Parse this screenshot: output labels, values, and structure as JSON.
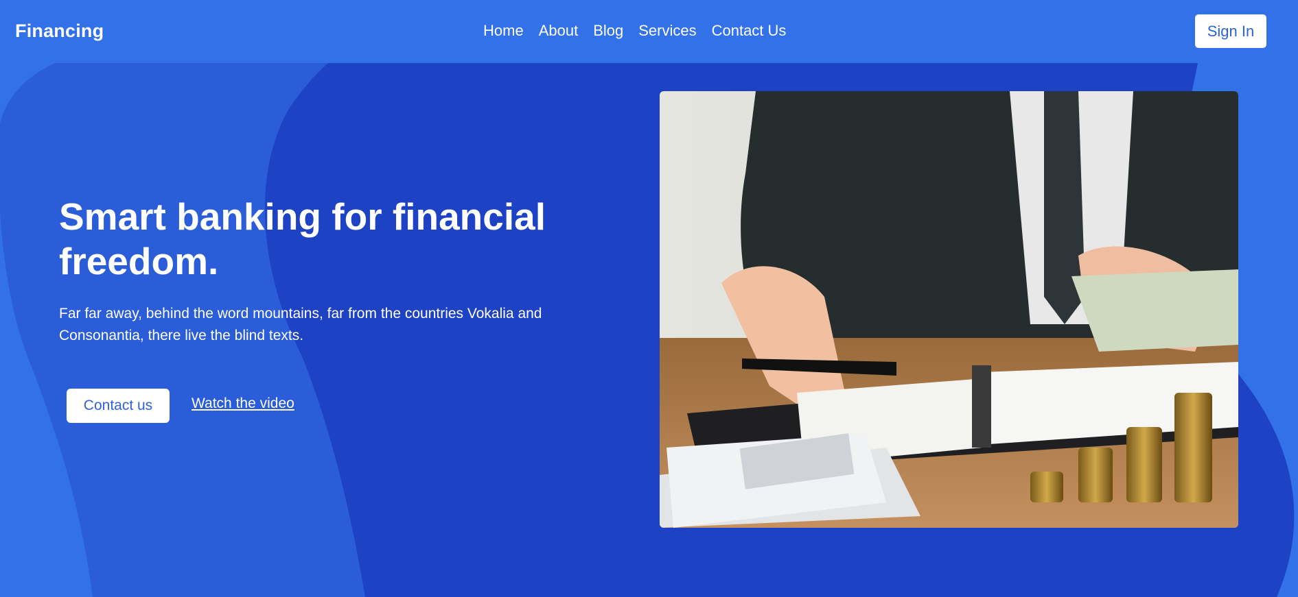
{
  "brand": {
    "name": "Financing"
  },
  "nav": {
    "items": [
      {
        "label": "Home"
      },
      {
        "label": "About"
      },
      {
        "label": "Blog"
      },
      {
        "label": "Services"
      },
      {
        "label": "Contact Us"
      }
    ],
    "signin_label": "Sign In"
  },
  "hero": {
    "title": "Smart banking for financial freedom.",
    "description": "Far far away, behind the word mountains, far from the countries Vokalia and Consonantia, there live the blind texts.",
    "contact_label": "Contact us",
    "video_label": "Watch the video",
    "image_subject": "businessman counting money with calculator, pen, notebook and coin stacks"
  },
  "colors": {
    "page_bg": "#3371e8",
    "wave_mid": "#2b5dd8",
    "wave_dark": "#1d42c4",
    "button_text": "#2f62d8",
    "white": "#ffffff"
  }
}
